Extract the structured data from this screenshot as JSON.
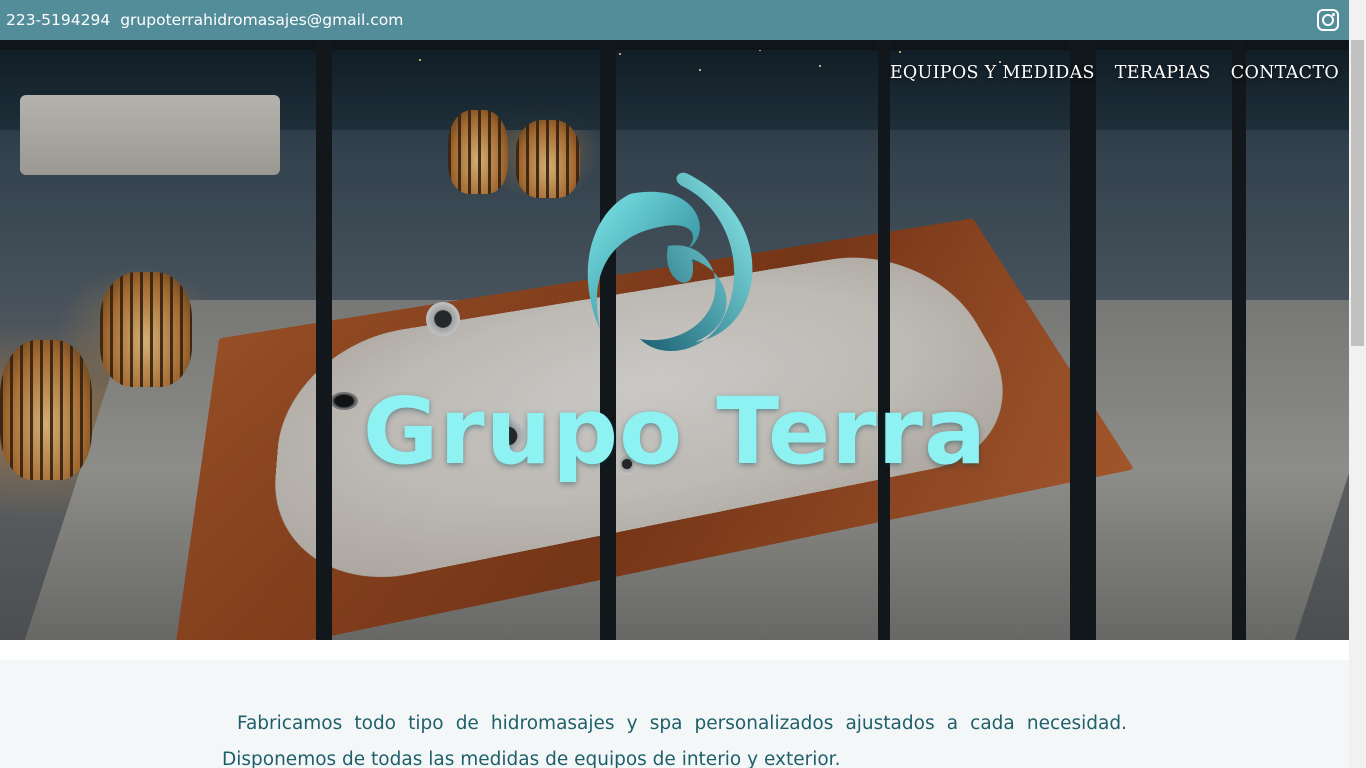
{
  "topbar": {
    "phone": "223-5194294",
    "email": "grupoterrahidromasajes@gmail.com",
    "social_icon": "instagram-icon"
  },
  "nav": {
    "items": [
      {
        "label": "EQUIPOS Y MEDIDAS"
      },
      {
        "label": "TERAPIAS"
      },
      {
        "label": "CONTACTO"
      }
    ]
  },
  "hero": {
    "brand": "Grupo Terra",
    "logo_icon": "wave-logo-icon",
    "colors": {
      "brand_text": "#8ff2f2",
      "logo_light": "#6fe3e6",
      "logo_dark": "#1d6e80"
    }
  },
  "intro": {
    "text": "Fabricamos todo tipo de hidromasajes y spa personalizados ajustados a cada necesidad. Disponemos de todas las medidas de equipos de interio y exterior."
  },
  "colors": {
    "topbar": "#538d9a",
    "intro_text": "#1f5f6a",
    "intro_bg": "#f4f7f7"
  }
}
